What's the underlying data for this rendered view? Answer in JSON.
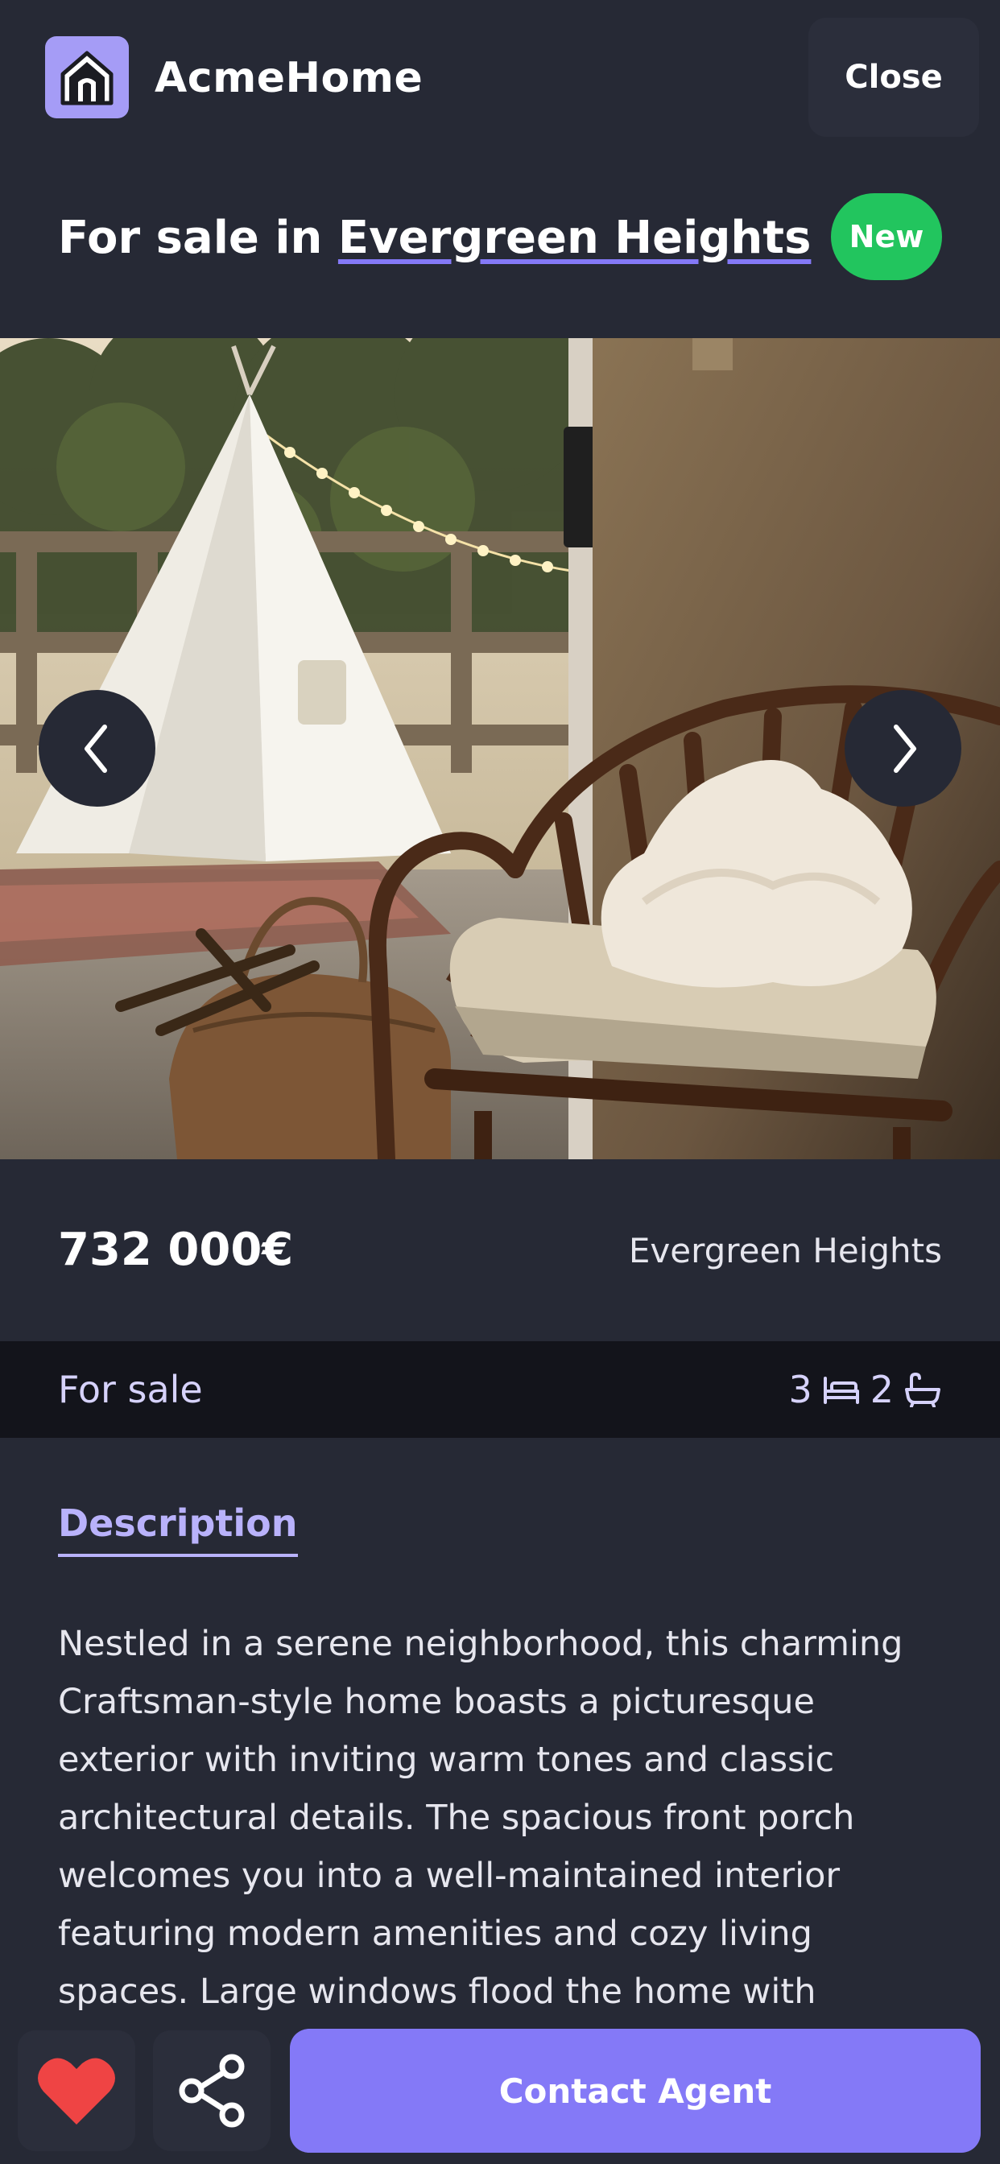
{
  "header": {
    "app_name": "AcmeHome",
    "close_label": "Close"
  },
  "listing": {
    "title_prefix": "For sale in ",
    "title_link": "Evergreen Heights",
    "badge": "New",
    "price": "732 000€",
    "location": "Evergreen Heights",
    "status": "For sale",
    "bedrooms": "3",
    "bathrooms": "2"
  },
  "description": {
    "heading": "Description",
    "body": "Nestled in a serene neighborhood, this charming Craftsman-style home boasts a picturesque exterior with inviting warm tones and classic architectural details. The spacious front porch welcomes you into a well-maintained interior featuring modern amenities and cozy living spaces. Large windows flood the home with"
  },
  "actions": {
    "contact_label": "Contact Agent"
  },
  "icons": {
    "logo": "house-logo-icon",
    "prev": "chevron-left-icon",
    "next": "chevron-right-icon",
    "bed": "bed-icon",
    "bath": "bathtub-icon",
    "favorite": "heart-icon",
    "share": "share-icon"
  },
  "colors": {
    "background": "#262935",
    "accent": "#8479f7",
    "logo_bg": "#a59cf6",
    "badge_green": "#22c55e",
    "favorite_red": "#ef4444",
    "status_bar": "#13141b"
  }
}
